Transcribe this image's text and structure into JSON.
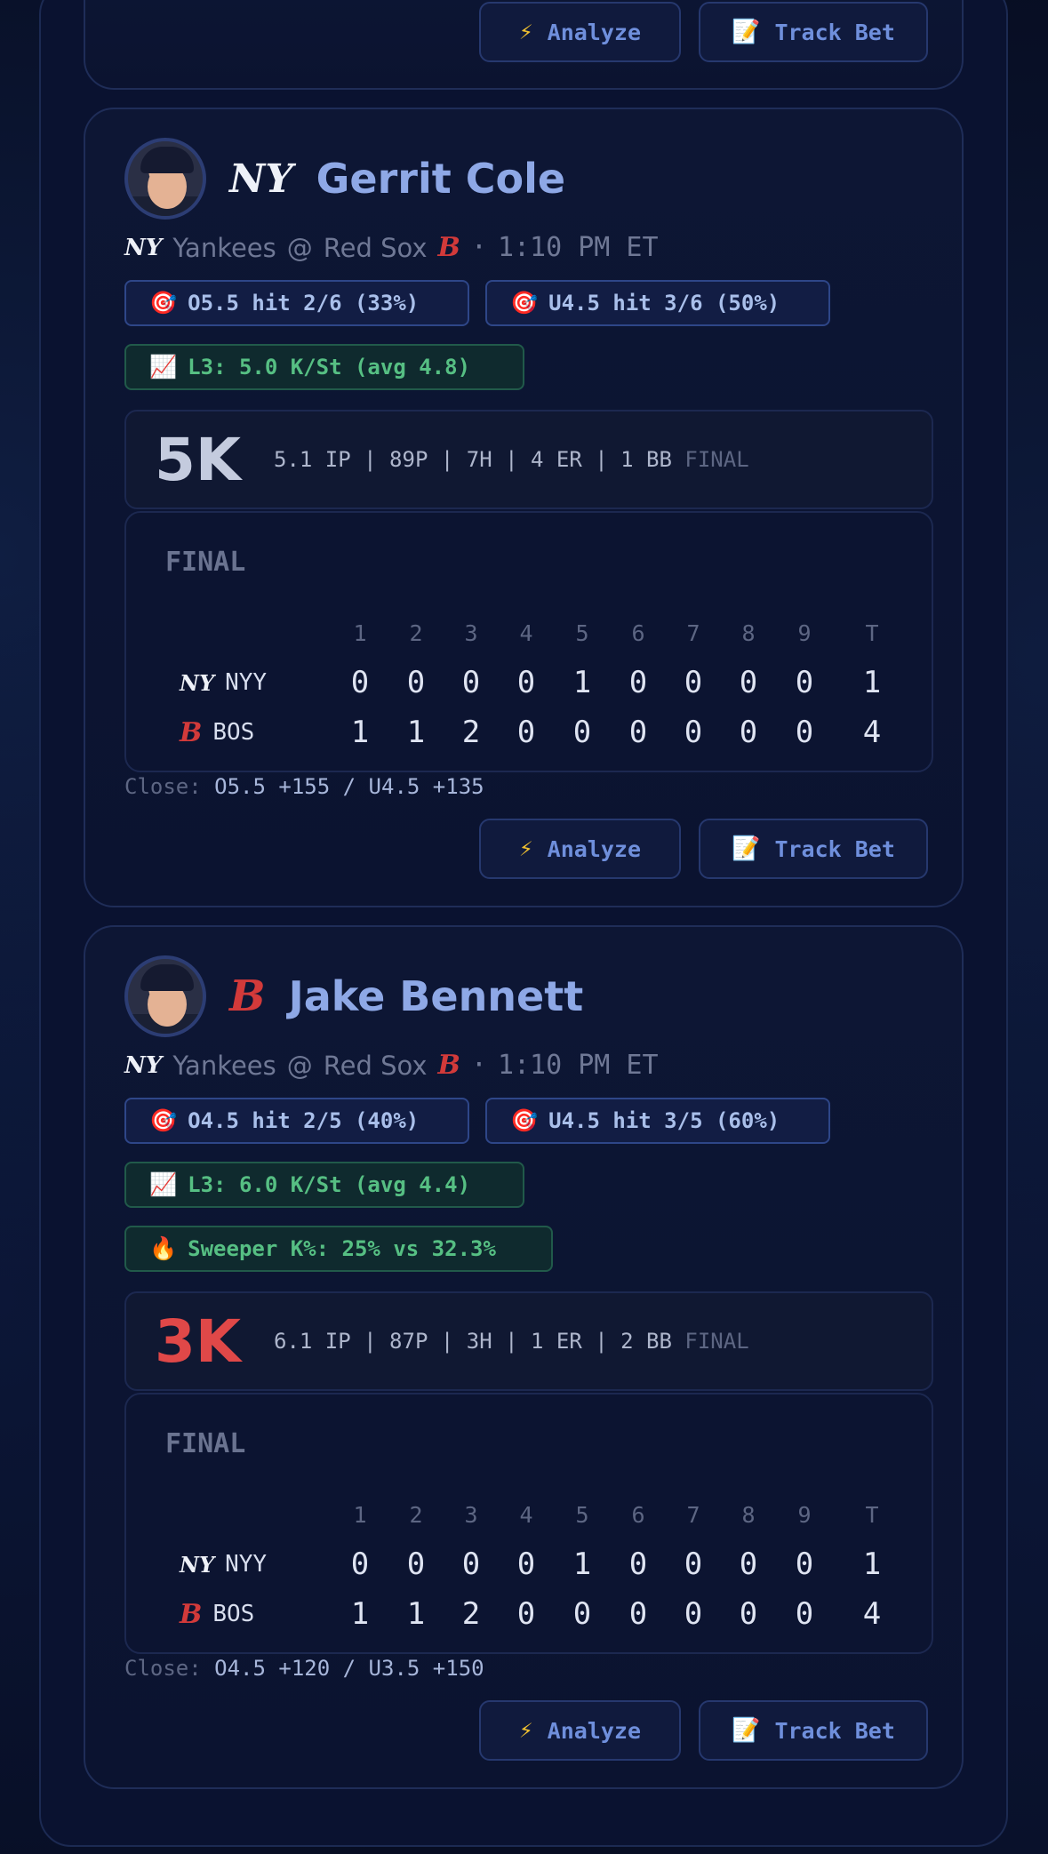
{
  "buttons": {
    "analyze": "Analyze",
    "track": "Track Bet"
  },
  "innings": [
    "1",
    "2",
    "3",
    "4",
    "5",
    "6",
    "7",
    "8",
    "9",
    "T"
  ],
  "cards": [
    {
      "player": "Gerrit Cole",
      "team_logo": "NY",
      "matchup_away": "Yankees",
      "matchup_at": "@",
      "matchup_home": "Red Sox",
      "time": "1:10 PM ET",
      "pill_over": "O5.5 hit 2/6 (33%)",
      "pill_under": "U4.5 hit 3/6 (50%)",
      "pill_l3": "L3: 5.0 K/St (avg 4.8)",
      "k_value": "5K",
      "k_color": "#c4cbde",
      "statline": "5.1 IP | 89P | 7H | 4 ER | 1 BB",
      "status": "FINAL",
      "box_title": "FINAL",
      "away_abbr": "NYY",
      "home_abbr": "BOS",
      "away_runs": [
        "0",
        "0",
        "0",
        "0",
        "1",
        "0",
        "0",
        "0",
        "0",
        "1"
      ],
      "home_runs": [
        "1",
        "1",
        "2",
        "0",
        "0",
        "0",
        "0",
        "0",
        "0",
        "4"
      ],
      "close_label": "Close:",
      "close_odds": "O5.5 +155 / U4.5 +135"
    },
    {
      "player": "Jake Bennett",
      "team_logo": "B",
      "matchup_away": "Yankees",
      "matchup_at": "@",
      "matchup_home": "Red Sox",
      "time": "1:10 PM ET",
      "pill_over": "O4.5 hit 2/5 (40%)",
      "pill_under": "U4.5 hit 3/5 (60%)",
      "pill_l3": "L3: 6.0 K/St (avg 4.4)",
      "pill_sweeper": "Sweeper K%: 25% vs 32.3%",
      "k_value": "3K",
      "k_color": "#e04848",
      "statline": "6.1 IP | 87P | 3H | 1 ER | 2 BB",
      "status": "FINAL",
      "box_title": "FINAL",
      "away_abbr": "NYY",
      "home_abbr": "BOS",
      "away_runs": [
        "0",
        "0",
        "0",
        "0",
        "1",
        "0",
        "0",
        "0",
        "0",
        "1"
      ],
      "home_runs": [
        "1",
        "1",
        "2",
        "0",
        "0",
        "0",
        "0",
        "0",
        "0",
        "4"
      ],
      "close_label": "Close:",
      "close_odds": "O4.5 +120 / U3.5 +150"
    }
  ]
}
